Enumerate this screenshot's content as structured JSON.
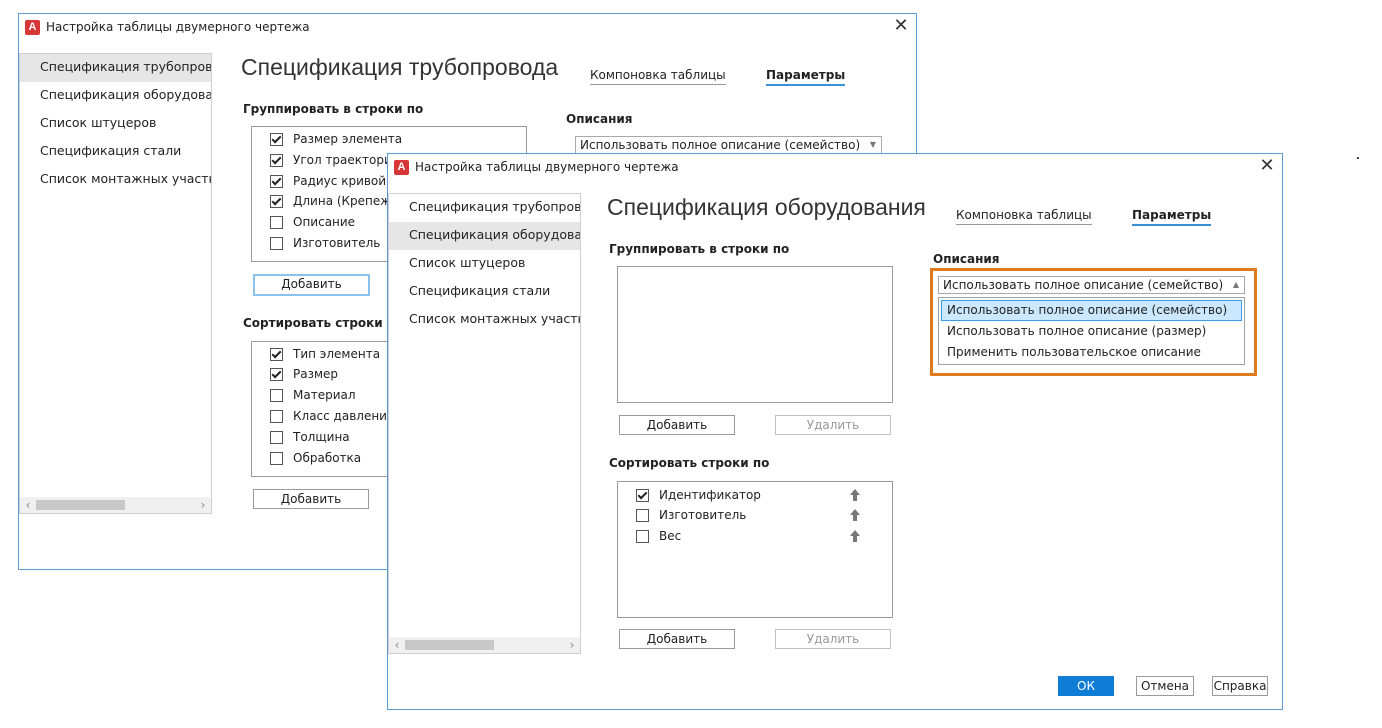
{
  "window_back": {
    "title": "Настройка таблицы двумерного чертежа",
    "nav": [
      "Спецификация трубопровода",
      "Спецификация оборудования",
      "Список штуцеров",
      "Спецификация стали",
      "Список монтажных участков"
    ],
    "heading": "Спецификация трубопровода",
    "tab_layout": "Компоновка таблицы",
    "tab_params": "Параметры",
    "group_label": "Группировать в строки по",
    "group_items": [
      {
        "label": "Размер элемента",
        "checked": true
      },
      {
        "label": "Угол траектории",
        "checked": true
      },
      {
        "label": "Радиус кривой (",
        "checked": true
      },
      {
        "label": "Длина (Крепежи",
        "checked": true
      },
      {
        "label": "Описание",
        "checked": false
      },
      {
        "label": "Изготовитель",
        "checked": false
      }
    ],
    "add_label": "Добавить",
    "sort_label": "Сортировать строки по",
    "sort_items": [
      {
        "label": "Тип элемента",
        "checked": true
      },
      {
        "label": "Размер",
        "checked": true
      },
      {
        "label": "Материал",
        "checked": false
      },
      {
        "label": "Класс давления",
        "checked": false
      },
      {
        "label": "Толщина",
        "checked": false
      },
      {
        "label": "Обработка",
        "checked": false
      }
    ],
    "add_label2": "Добавить",
    "desc_label": "Описания",
    "desc_value": "Использовать полное описание (семейство)"
  },
  "window_front": {
    "title": "Настройка таблицы двумерного чертежа",
    "nav": [
      "Спецификация трубопровода",
      "Спецификация оборудования",
      "Список штуцеров",
      "Спецификация стали",
      "Список монтажных участков"
    ],
    "heading": "Спецификация оборудования",
    "tab_layout": "Компоновка таблицы",
    "tab_params": "Параметры",
    "group_label": "Группировать в строки по",
    "add_label": "Добавить",
    "delete_label": "Удалить",
    "sort_label": "Сортировать строки по",
    "sort_items": [
      {
        "label": "Идентификатор",
        "checked": true
      },
      {
        "label": "Изготовитель",
        "checked": false
      },
      {
        "label": "Вес",
        "checked": false
      }
    ],
    "add_label2": "Добавить",
    "delete_label2": "Удалить",
    "desc_label": "Описания",
    "desc_value": "Использовать полное описание (семейство)",
    "desc_options": [
      "Использовать полное описание (семейство)",
      "Использовать полное описание (размер)",
      "Применить пользовательское описание"
    ],
    "ok": "ОК",
    "cancel": "Отмена",
    "help": "Справка"
  },
  "colors": {
    "accent": "#0f7dd5",
    "highlight": "#e07a1f",
    "selection": "#cce8ff"
  }
}
